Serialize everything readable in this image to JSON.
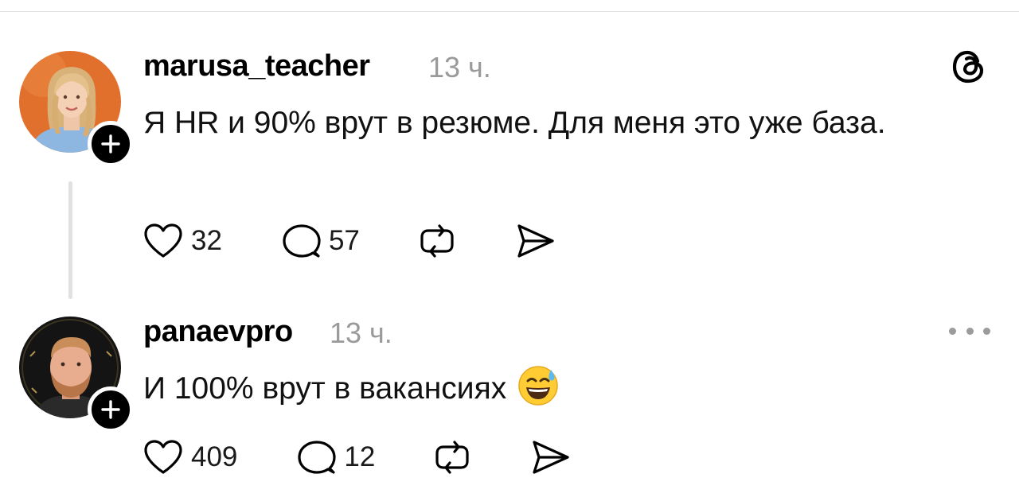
{
  "posts": [
    {
      "username": "marusa_teacher",
      "time": "13 ч.",
      "text": "Я HR и 90% врут в резюме. Для меня это уже база.",
      "likes": "32",
      "replies": "57",
      "avatar_icon": "avatar-woman-photo",
      "corner_icon": "threads-logo-icon"
    },
    {
      "username": "panaevpro",
      "time": "13 ч.",
      "text": "И 100% врут в вакансиях",
      "emoji": "😅",
      "likes": "409",
      "replies": "12",
      "avatar_icon": "avatar-man-photo",
      "corner_icon": "more-options-icon"
    }
  ],
  "icons": {
    "like": "heart-icon",
    "reply": "speech-bubble-icon",
    "repost": "repost-icon",
    "share": "send-icon",
    "follow": "plus-icon"
  },
  "colors": {
    "text": "#000000",
    "muted": "#9a9a9a",
    "divider": "#e3e3e3"
  }
}
